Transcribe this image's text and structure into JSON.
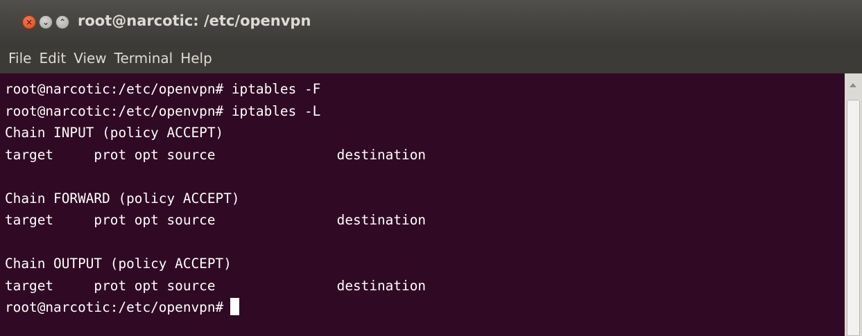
{
  "window": {
    "title": "root@narcotic: /etc/openvpn",
    "buttons": {
      "close": "×",
      "minimize": "⌄",
      "maximize": "⌃"
    }
  },
  "menubar": {
    "items": [
      "File",
      "Edit",
      "View",
      "Terminal",
      "Help"
    ]
  },
  "terminal": {
    "lines": [
      "root@narcotic:/etc/openvpn# iptables -F",
      "root@narcotic:/etc/openvpn# iptables -L",
      "Chain INPUT (policy ACCEPT)",
      "target     prot opt source               destination",
      "",
      "Chain FORWARD (policy ACCEPT)",
      "target     prot opt source               destination",
      "",
      "Chain OUTPUT (policy ACCEPT)",
      "target     prot opt source               destination"
    ],
    "prompt": "root@narcotic:/etc/openvpn#"
  },
  "colors": {
    "terminal_bg": "#300a24",
    "terminal_fg": "#ffffff",
    "titlebar_bg": "#3c3b37",
    "close_button": "#e8602e"
  }
}
